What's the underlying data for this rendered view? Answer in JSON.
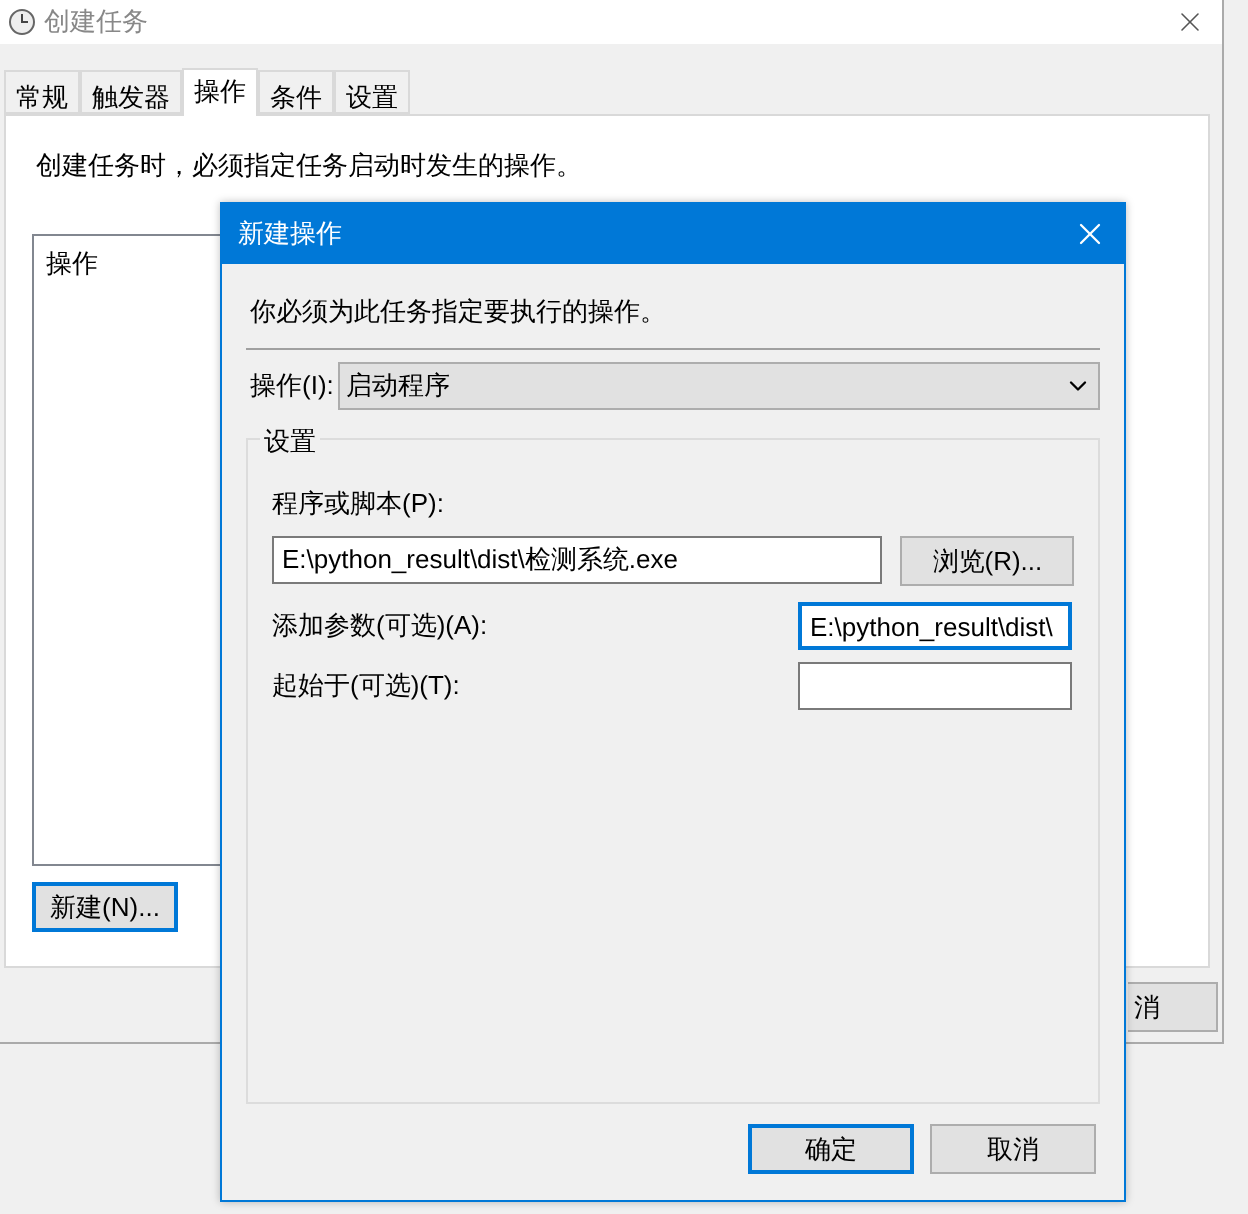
{
  "window": {
    "title": "创建任务"
  },
  "tabs": [
    {
      "label": "常规",
      "selected": false
    },
    {
      "label": "触发器",
      "selected": false
    },
    {
      "label": "操作",
      "selected": true
    },
    {
      "label": "条件",
      "selected": false
    },
    {
      "label": "设置",
      "selected": false
    }
  ],
  "description": "创建任务时，必须指定任务启动时发生的操作。",
  "actions_list": {
    "column_header": "操作"
  },
  "new_button": {
    "label": "新建(N)...",
    "focused": true
  },
  "cancel_button_partial": "消",
  "dialog": {
    "title": "新建操作",
    "instruction": "你必须为此任务指定要执行的操作。",
    "action": {
      "label": "操作(I):",
      "value": "启动程序"
    },
    "group_title": "设置",
    "fields": [
      {
        "label": "程序或脚本(P):",
        "value": "E:\\python_result\\dist\\检测系统.exe",
        "focused": false,
        "kind": "wide"
      },
      {
        "label": "添加参数(可选)(A):",
        "value": "E:\\python_result\\dist\\",
        "focused": true,
        "kind": "inline"
      },
      {
        "label": "起始于(可选)(T):",
        "focused": false,
        "kind": "inline"
      }
    ],
    "browse_button": "浏览(R)...",
    "buttons": [
      {
        "label": "确定",
        "default": true
      },
      {
        "label": "取消",
        "default": false
      }
    ]
  }
}
